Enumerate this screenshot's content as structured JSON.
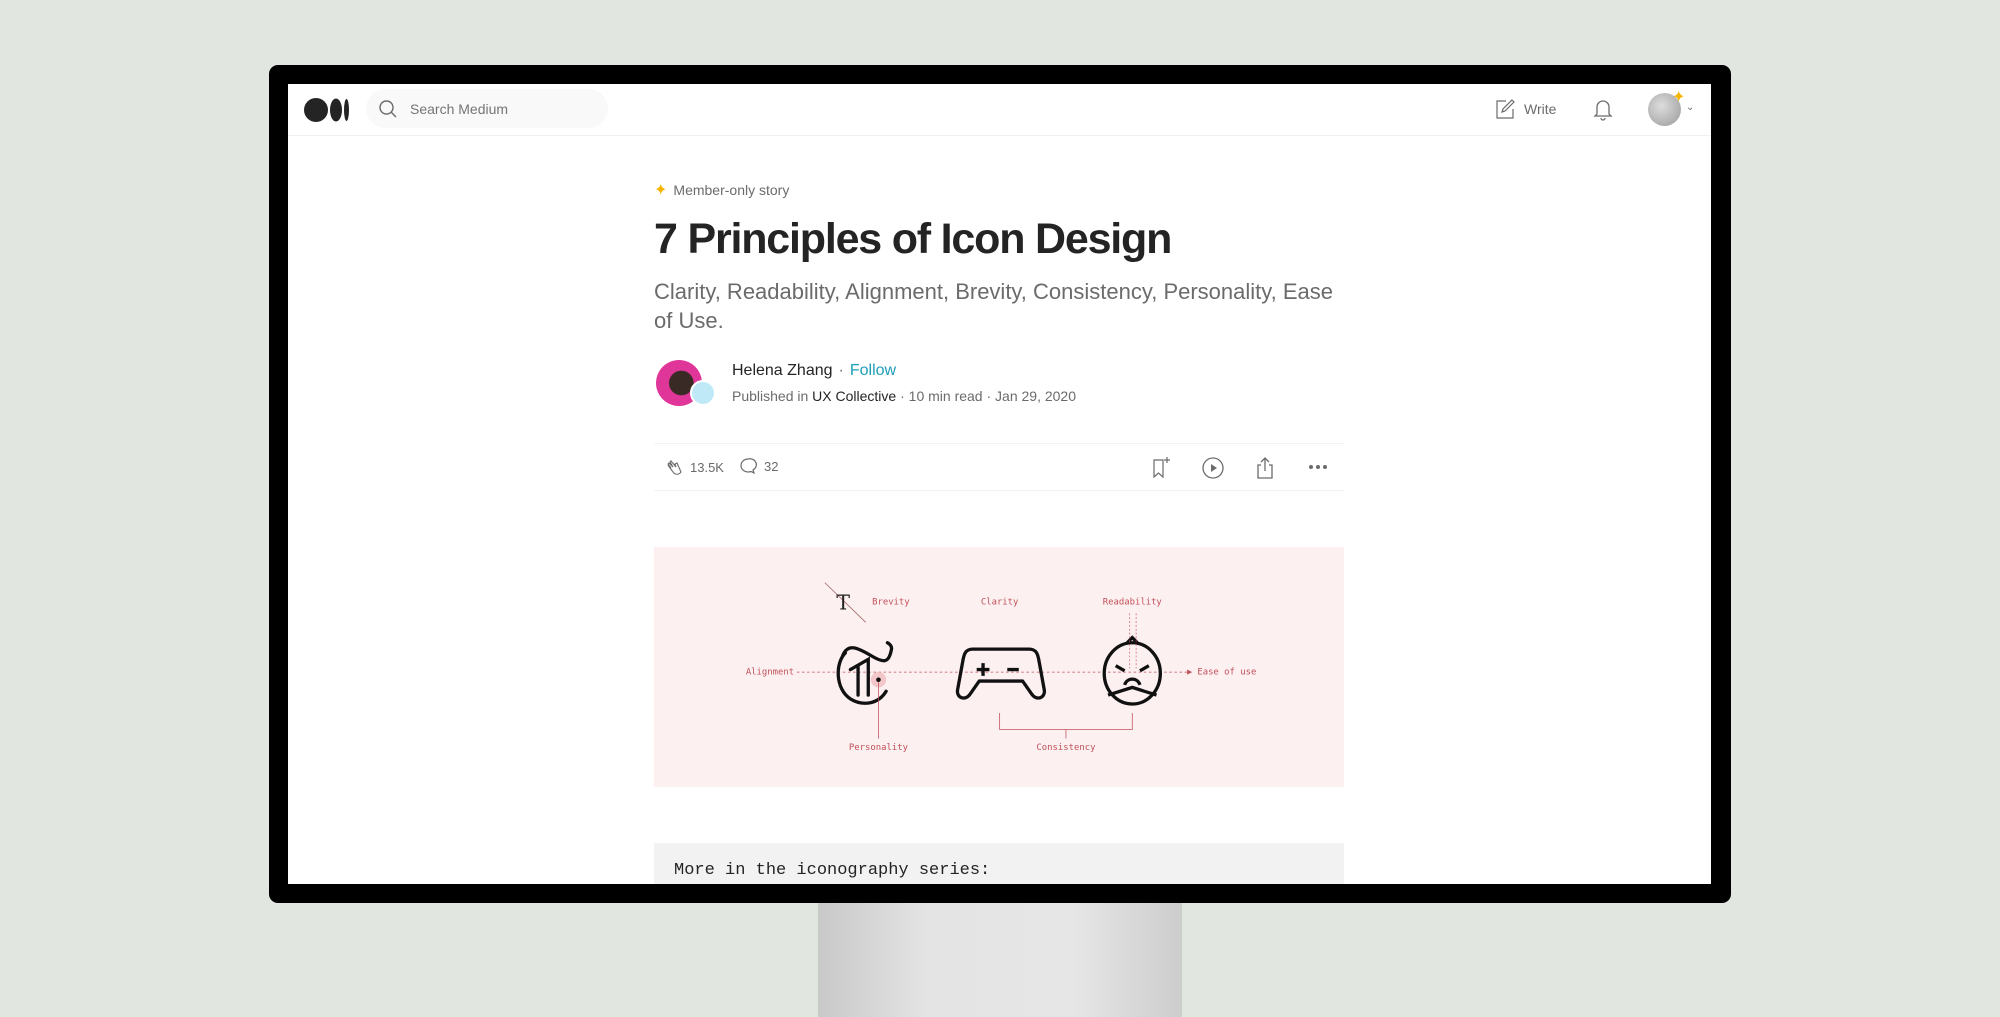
{
  "nav": {
    "search_placeholder": "Search Medium",
    "write_label": "Write"
  },
  "article": {
    "badge": "Member-only story",
    "title": "7 Principles of Icon Design",
    "subtitle": "Clarity, Readability, Alignment, Brevity, Consistency, Personality, Ease of Use.",
    "author": "Helena Zhang",
    "follow": "Follow",
    "published_in_label": "Published in",
    "publication": "UX Collective",
    "read_time": "10 min read",
    "date": "Jan 29, 2020",
    "claps": "13.5K",
    "responses": "32"
  },
  "figure": {
    "labels": {
      "brevity": "Brevity",
      "clarity": "Clarity",
      "readability": "Readability",
      "alignment": "Alignment",
      "ease": "Ease of use",
      "personality": "Personality",
      "consistency": "Consistency"
    }
  },
  "code_block": "More in the iconography series:",
  "colors": {
    "accent_follow": "#1c9fb8",
    "member_star": "#f5b400",
    "figure_bg": "#fdf0f0",
    "figure_ink": "#c0505a"
  }
}
